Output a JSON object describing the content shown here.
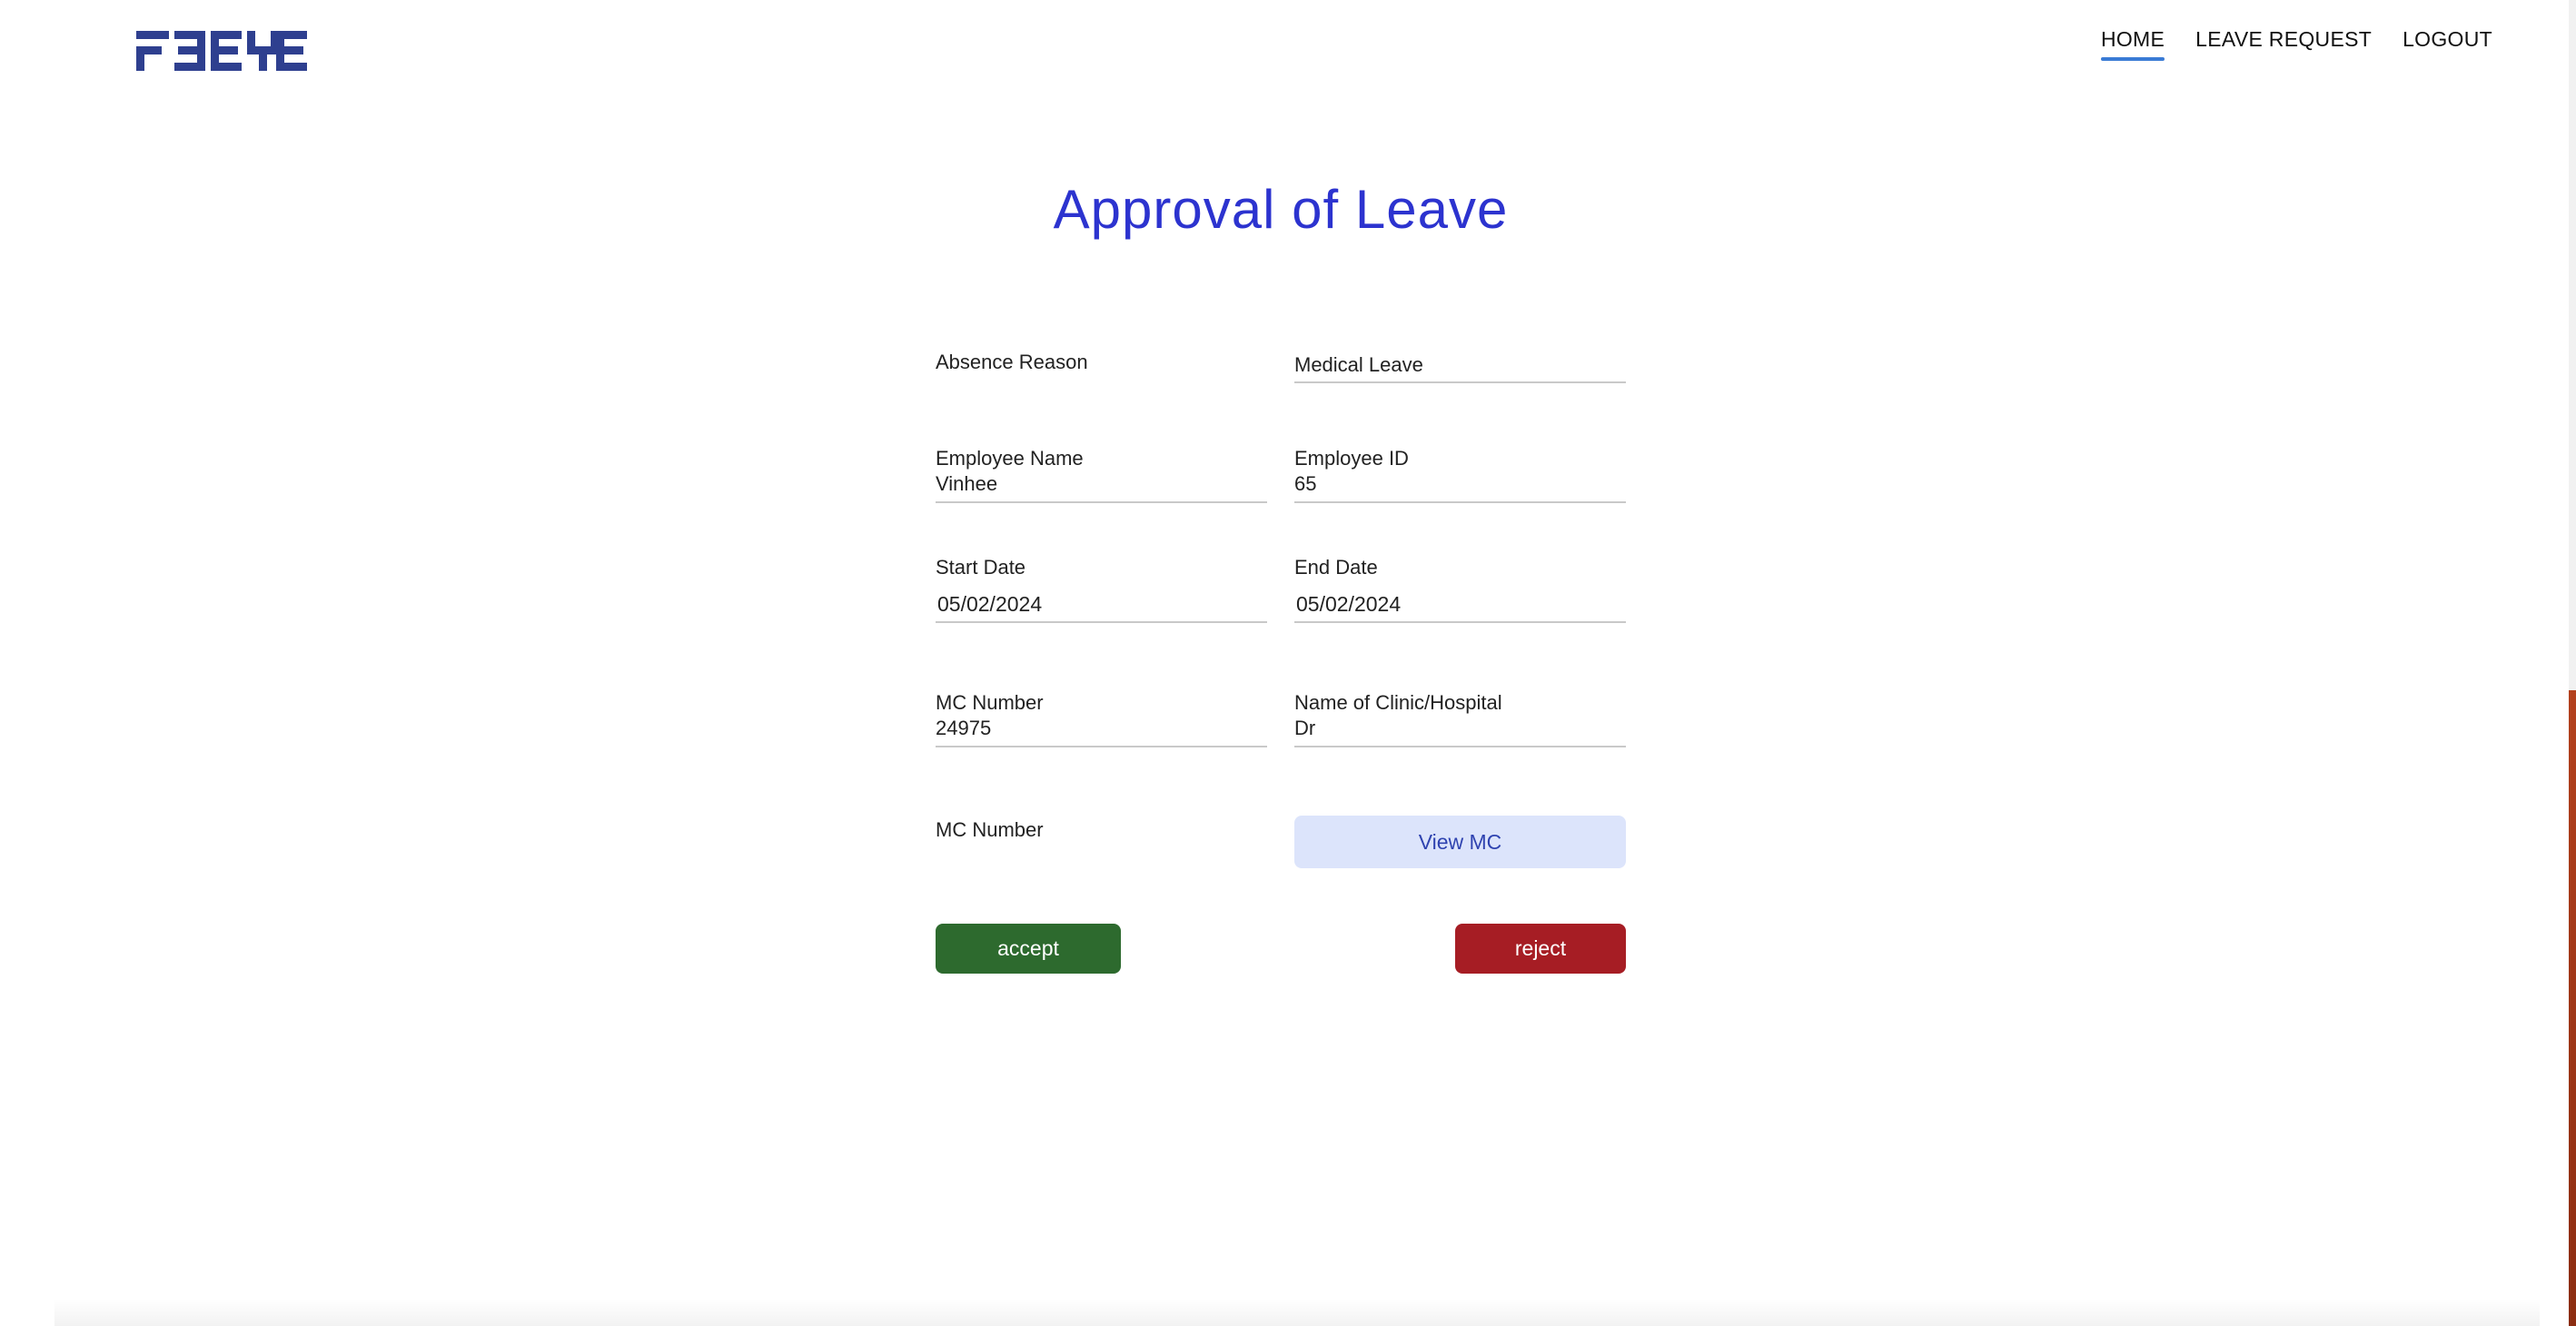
{
  "app": {
    "logo_text": "FBEYE"
  },
  "nav": {
    "items": [
      {
        "label": "HOME",
        "active": true
      },
      {
        "label": "LEAVE REQUEST",
        "active": false
      },
      {
        "label": "LOGOUT",
        "active": false
      }
    ]
  },
  "page": {
    "title": "Approval of Leave"
  },
  "form": {
    "absence_reason": {
      "label": "Absence Reason",
      "value": "Medical Leave"
    },
    "employee_name": {
      "label": "Employee Name",
      "value": "Vinhee"
    },
    "employee_id": {
      "label": "Employee ID",
      "value": "65"
    },
    "start_date": {
      "label": "Start Date",
      "value": "05/02/2024"
    },
    "end_date": {
      "label": "End Date",
      "value": "05/02/2024"
    },
    "mc_number": {
      "label": "MC Number",
      "value": "24975"
    },
    "clinic_name": {
      "label": "Name of Clinic/Hospital",
      "value": "Dr"
    },
    "mc_attachment": {
      "label": "MC Number",
      "button_label": "View MC"
    }
  },
  "actions": {
    "accept_label": "accept",
    "reject_label": "reject"
  },
  "colors": {
    "title": "#2c33cf",
    "logo": "#2e3f8f",
    "nav_active_underline": "#3a7bd5",
    "view_mc_bg": "#dce4fb",
    "accept": "#2d6a2e",
    "reject": "#a61d24"
  },
  "icons": {
    "logo": "fbeye-logo"
  }
}
